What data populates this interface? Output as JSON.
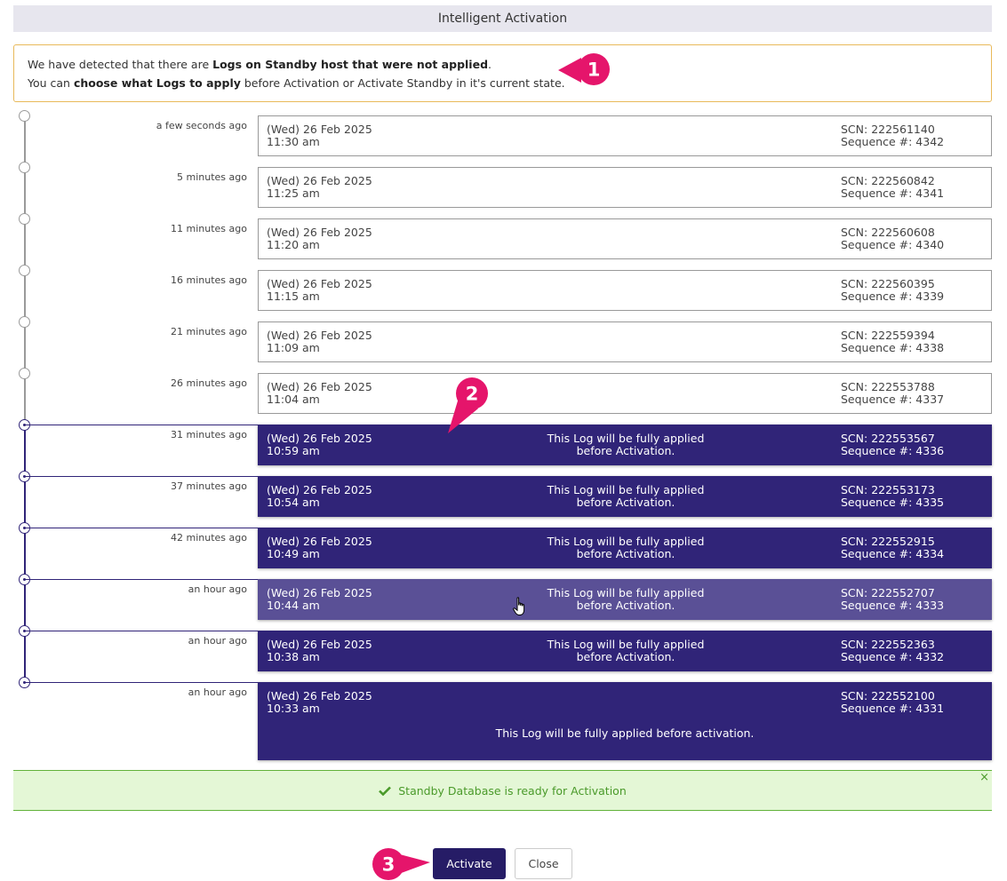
{
  "dialog": {
    "title": "Intelligent Activation"
  },
  "notice": {
    "line1_prefix": "We have detected that there are ",
    "line1_bold": "Logs on Standby host that were not applied",
    "line1_suffix": ".",
    "line2_prefix": "You can ",
    "line2_bold": "choose what Logs to apply",
    "line2_suffix": " before Activation or Activate Standby in it's current state."
  },
  "callouts": {
    "c1": "1",
    "c2": "2",
    "c3": "3",
    "color": "#e5156b"
  },
  "logs": [
    {
      "ago": "a few seconds ago",
      "date": "(Wed)  26 Feb 2025",
      "time": "11:30 am",
      "scn": "SCN: 222561140",
      "seq": "Sequence #: 4342",
      "selected": false
    },
    {
      "ago": "5 minutes ago",
      "date": "(Wed)  26 Feb 2025",
      "time": "11:25 am",
      "scn": "SCN: 222560842",
      "seq": "Sequence #: 4341",
      "selected": false
    },
    {
      "ago": "11 minutes ago",
      "date": "(Wed)  26 Feb 2025",
      "time": "11:20 am",
      "scn": "SCN: 222560608",
      "seq": "Sequence #: 4340",
      "selected": false
    },
    {
      "ago": "16 minutes ago",
      "date": "(Wed)  26 Feb 2025",
      "time": "11:15 am",
      "scn": "SCN: 222560395",
      "seq": "Sequence #: 4339",
      "selected": false
    },
    {
      "ago": "21 minutes ago",
      "date": "(Wed)  26 Feb 2025",
      "time": "11:09 am",
      "scn": "SCN: 222559394",
      "seq": "Sequence #: 4338",
      "selected": false
    },
    {
      "ago": "26 minutes ago",
      "date": "(Wed)  26 Feb 2025",
      "time": "11:04 am",
      "scn": "SCN: 222553788",
      "seq": "Sequence #: 4337",
      "selected": false
    },
    {
      "ago": "31 minutes ago",
      "date": "(Wed)  26 Feb 2025",
      "time": "10:59 am",
      "scn": "SCN: 222553567",
      "seq": "Sequence #: 4336",
      "selected": true,
      "applied_1": "This Log will be fully applied",
      "applied_2": "before Activation."
    },
    {
      "ago": "37 minutes ago",
      "date": "(Wed)  26 Feb 2025",
      "time": "10:54 am",
      "scn": "SCN: 222553173",
      "seq": "Sequence #: 4335",
      "selected": true,
      "applied_1": "This Log will be fully applied",
      "applied_2": "before Activation."
    },
    {
      "ago": "42 minutes ago",
      "date": "(Wed)  26 Feb 2025",
      "time": "10:49 am",
      "scn": "SCN: 222552915",
      "seq": "Sequence #: 4334",
      "selected": true,
      "applied_1": "This Log will be fully applied",
      "applied_2": "before Activation."
    },
    {
      "ago": "an hour ago",
      "date": "(Wed)  26 Feb 2025",
      "time": "10:44 am",
      "scn": "SCN: 222552707",
      "seq": "Sequence #: 4333",
      "selected": true,
      "hover": true,
      "applied_1": "This Log will be fully applied",
      "applied_2": "before Activation."
    },
    {
      "ago": "an hour ago",
      "date": "(Wed)  26 Feb 2025",
      "time": "10:38 am",
      "scn": "SCN: 222552363",
      "seq": "Sequence #: 4332",
      "selected": true,
      "applied_1": "This Log will be fully applied",
      "applied_2": "before Activation."
    },
    {
      "ago": "an hour ago",
      "date": "(Wed)  26 Feb 2025",
      "time": "10:33 am",
      "scn": "SCN: 222552100",
      "seq": "Sequence #: 4331",
      "selected": true,
      "applied_long": "This Log will be fully applied before activation."
    }
  ],
  "status": {
    "message": "Standby Database is ready for Activation",
    "close_glyph": "×"
  },
  "buttons": {
    "activate": "Activate",
    "close": "Close"
  },
  "colors": {
    "selected": "#302478",
    "hover": "#5a5096",
    "success_bg": "#e4f7d6",
    "success_text": "#4a9a2a",
    "notice_border": "#e8b95a"
  }
}
